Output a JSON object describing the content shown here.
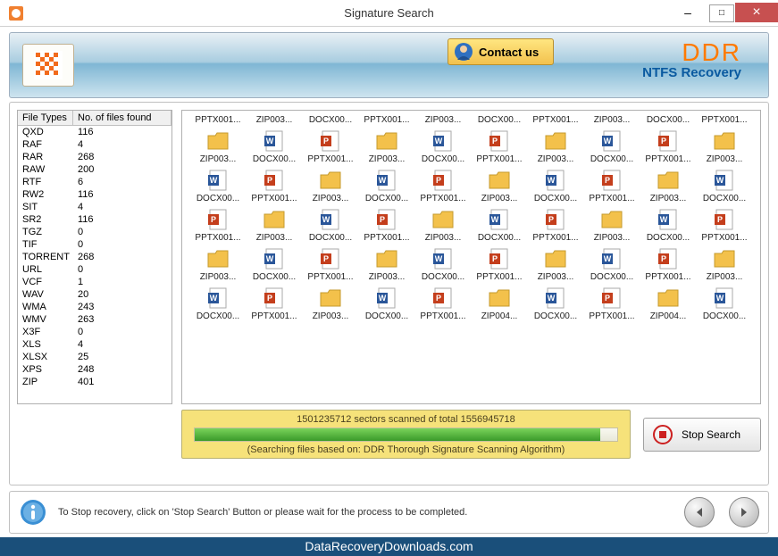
{
  "window": {
    "title": "Signature Search",
    "minimize": "–",
    "maximize": "□",
    "close": "×"
  },
  "header": {
    "contact_label": "Contact us",
    "brand": "DDR",
    "brand_sub": "NTFS Recovery"
  },
  "left_table": {
    "col1": "File Types",
    "col2": "No. of files found",
    "rows": [
      {
        "t": "QXD",
        "n": "116"
      },
      {
        "t": "RAF",
        "n": "4"
      },
      {
        "t": "RAR",
        "n": "268"
      },
      {
        "t": "RAW",
        "n": "200"
      },
      {
        "t": "RTF",
        "n": "6"
      },
      {
        "t": "RW2",
        "n": "116"
      },
      {
        "t": "SIT",
        "n": "4"
      },
      {
        "t": "SR2",
        "n": "116"
      },
      {
        "t": "TGZ",
        "n": "0"
      },
      {
        "t": "TIF",
        "n": "0"
      },
      {
        "t": "TORRENT",
        "n": "268"
      },
      {
        "t": "URL",
        "n": "0"
      },
      {
        "t": "VCF",
        "n": "1"
      },
      {
        "t": "WAV",
        "n": "20"
      },
      {
        "t": "WMA",
        "n": "243"
      },
      {
        "t": "WMV",
        "n": "263"
      },
      {
        "t": "X3F",
        "n": "0"
      },
      {
        "t": "XLS",
        "n": "4"
      },
      {
        "t": "XLSX",
        "n": "25"
      },
      {
        "t": "XPS",
        "n": "248"
      },
      {
        "t": "ZIP",
        "n": "401"
      }
    ]
  },
  "grid": {
    "rows": [
      [
        "PPTX001...",
        "ZIP003...",
        "DOCX00...",
        "PPTX001...",
        "ZIP003...",
        "DOCX00...",
        "PPTX001...",
        "ZIP003...",
        "DOCX00...",
        "PPTX001..."
      ],
      [
        "ZIP003...",
        "DOCX00...",
        "PPTX001...",
        "ZIP003...",
        "DOCX00...",
        "PPTX001...",
        "ZIP003...",
        "DOCX00...",
        "PPTX001...",
        "ZIP003..."
      ],
      [
        "DOCX00...",
        "PPTX001...",
        "ZIP003...",
        "DOCX00...",
        "PPTX001...",
        "ZIP003...",
        "DOCX00...",
        "PPTX001...",
        "ZIP003...",
        "DOCX00..."
      ],
      [
        "PPTX001...",
        "ZIP003...",
        "DOCX00...",
        "PPTX001...",
        "ZIP003...",
        "DOCX00...",
        "PPTX001...",
        "ZIP003...",
        "DOCX00...",
        "PPTX001..."
      ],
      [
        "ZIP003...",
        "DOCX00...",
        "PPTX001...",
        "ZIP003...",
        "DOCX00...",
        "PPTX001...",
        "ZIP003...",
        "DOCX00...",
        "PPTX001...",
        "ZIP003..."
      ],
      [
        "DOCX00...",
        "PPTX001...",
        "ZIP003...",
        "DOCX00...",
        "PPTX001...",
        "ZIP004...",
        "DOCX00...",
        "PPTX001...",
        "ZIP004...",
        "DOCX00..."
      ]
    ],
    "icons": [
      [
        "",
        "",
        "",
        "",
        "",
        "",
        "",
        "",
        "",
        ""
      ],
      [
        "zip",
        "docx",
        "pptx",
        "zip",
        "docx",
        "pptx",
        "zip",
        "docx",
        "pptx",
        "zip"
      ],
      [
        "docx",
        "pptx",
        "zip",
        "docx",
        "pptx",
        "zip",
        "docx",
        "pptx",
        "zip",
        "docx"
      ],
      [
        "pptx",
        "zip",
        "docx",
        "pptx",
        "zip",
        "docx",
        "pptx",
        "zip",
        "docx",
        "pptx"
      ],
      [
        "zip",
        "docx",
        "pptx",
        "zip",
        "docx",
        "pptx",
        "zip",
        "docx",
        "pptx",
        "zip"
      ],
      [
        "docx",
        "pptx",
        "zip",
        "docx",
        "pptx",
        "zip",
        "docx",
        "pptx",
        "zip",
        "docx"
      ]
    ]
  },
  "status": {
    "sectors_text": "1501235712 sectors scanned of total 1556945718",
    "algo_text": "(Searching files based on:  DDR Thorough Signature Scanning Algorithm)",
    "stop_label": "Stop Search"
  },
  "footer": {
    "tip": "To Stop recovery, click on 'Stop Search' Button or please wait for the process to be completed."
  },
  "bottom_link": "DataRecoveryDownloads.com"
}
